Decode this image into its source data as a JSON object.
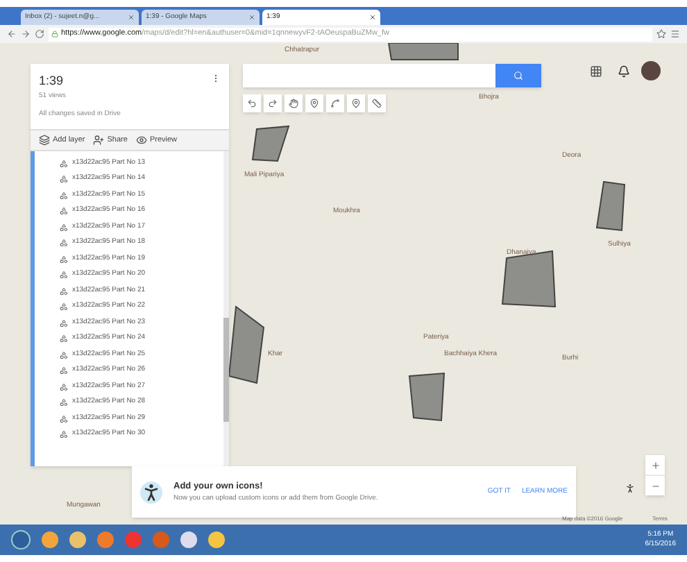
{
  "browser": {
    "tabs": [
      {
        "label": "Inbox (2) - sujeet.n@g...",
        "selected": false
      },
      {
        "label": "1:39 - Google Maps",
        "selected": false
      },
      {
        "label": "1:39",
        "selected": true
      }
    ],
    "url_host": "https://www.google.com",
    "url_path": "/maps/d/edit?hl=en&authuser=0&mid=1qnnewyvF2-tAOeuspaBuZMw_fw"
  },
  "map": {
    "labels": [
      "Chhatrapur",
      "Bhojra",
      "Mali Pipariya",
      "Moukhra",
      "Deora",
      "Dhanaiya",
      "Sulhiya",
      "Pateriya",
      "Khar",
      "Bachhaiya Khera",
      "Burhi",
      "Mungawan"
    ],
    "attribution": "Map data ©2016 Google",
    "terms": "Terms"
  },
  "panel": {
    "title": "1:39",
    "views": "51 views",
    "status": "All changes saved in Drive",
    "actions": [
      {
        "kind": "layer",
        "label": "Add layer"
      },
      {
        "kind": "share",
        "label": "Share"
      },
      {
        "kind": "preview",
        "label": "Preview"
      }
    ],
    "layers": [
      "x13d22ac95 Part No 13",
      "x13d22ac95 Part No 14",
      "x13d22ac95 Part No 15",
      "x13d22ac95 Part No 16",
      "x13d22ac95 Part No 17",
      "x13d22ac95 Part No 18",
      "x13d22ac95 Part No 19",
      "x13d22ac95 Part No 20",
      "x13d22ac95 Part No 21",
      "x13d22ac95 Part No 22",
      "x13d22ac95 Part No 23",
      "x13d22ac95 Part No 24",
      "x13d22ac95 Part No 25",
      "x13d22ac95 Part No 26",
      "x13d22ac95 Part No 27",
      "x13d22ac95 Part No 28",
      "x13d22ac95 Part No 29",
      "x13d22ac95 Part No 30"
    ]
  },
  "notice": {
    "title": "Add your own icons!",
    "body": "Now you can upload custom icons or add them from Google Drive.",
    "actions": [
      "GOT IT",
      "LEARN MORE"
    ]
  },
  "taskbar": {
    "time": "5:16 PM",
    "date": "6/15/2016"
  }
}
